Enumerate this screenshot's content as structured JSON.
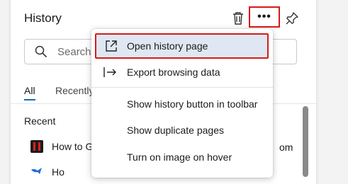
{
  "panel": {
    "title": "History",
    "header_icons": [
      "trash-icon",
      "more-options-icon",
      "pin-icon"
    ],
    "more_label": "•••",
    "search": {
      "placeholder": "Search history"
    },
    "tabs": [
      {
        "label": "All",
        "active": true
      },
      {
        "label": "Recently closed",
        "active": false
      }
    ],
    "section_label": "Recent",
    "items": [
      {
        "title": "How to G",
        "favicon": "red-youtube-like-icon",
        "trailing": "om"
      },
      {
        "title": "Ho",
        "favicon": "blue-bird-icon"
      }
    ]
  },
  "menu": {
    "items": [
      {
        "label": "Open history page",
        "icon": "open-external-icon",
        "highlighted": true
      },
      {
        "label": "Export browsing data",
        "icon": "export-arrow-icon"
      },
      {
        "label": "Show history button in toolbar",
        "icon": ""
      },
      {
        "label": "Show duplicate pages",
        "icon": ""
      },
      {
        "label": "Turn on image on hover",
        "icon": ""
      }
    ]
  },
  "colors": {
    "accent": "#0f6cbd",
    "highlight_outline": "#d51a1a",
    "highlight_fill": "#dfe8f2"
  }
}
